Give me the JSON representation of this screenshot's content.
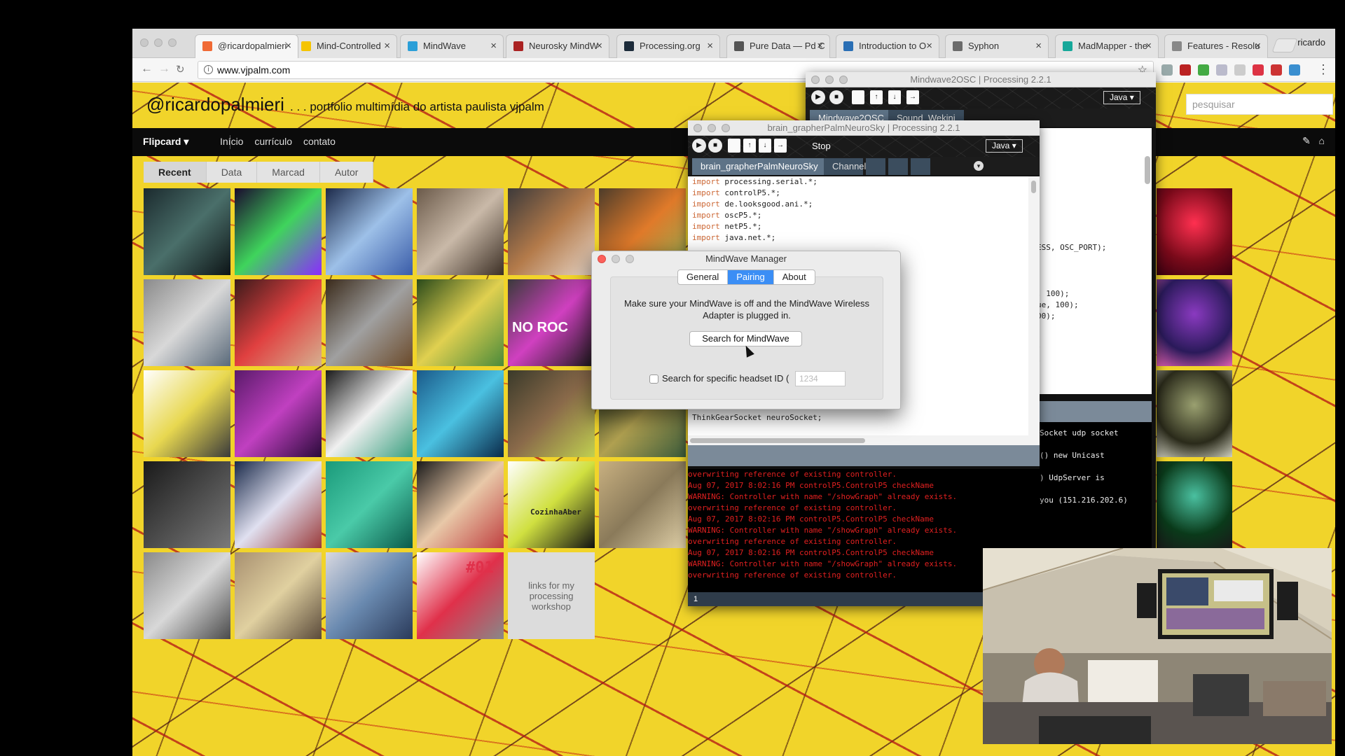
{
  "browser": {
    "profile": "ricardo",
    "url": "www.vjpalm.com",
    "tabs": [
      {
        "label": "@ricardopalmieri",
        "favicon": "blogger-icon",
        "color": "#f06a35"
      },
      {
        "label": "Mind-Controlled",
        "favicon": "instructables-icon",
        "color": "#f5c400"
      },
      {
        "label": "MindWave",
        "favicon": "globe-icon",
        "color": "#2b9fd8"
      },
      {
        "label": "Neurosky MindW",
        "favicon": "neurosky-icon",
        "color": "#aa2222"
      },
      {
        "label": "Processing.org",
        "favicon": "processing-icon",
        "color": "#1c2b3a"
      },
      {
        "label": "Pure Data — Pd C",
        "favicon": "puredata-icon",
        "color": "#555555"
      },
      {
        "label": "Introduction to O",
        "favicon": "globe-icon",
        "color": "#2a6fb5"
      },
      {
        "label": "Syphon",
        "favicon": "syphon-icon",
        "color": "#6b6b6b"
      },
      {
        "label": "MadMapper - the",
        "favicon": "madmapper-icon",
        "color": "#16a89a"
      },
      {
        "label": "Features - Resolu",
        "favicon": "document-icon",
        "color": "#888888"
      }
    ]
  },
  "site": {
    "title": "@ricardopalmieri",
    "tagline": ". . . portfolio multimídia do artista paulista vjpalm",
    "nav_menu": "Flipcard",
    "nav_links": [
      "Início",
      "currículo",
      "contato"
    ],
    "search_placeholder": "pesquisar",
    "filters": [
      "Recent",
      "Data",
      "Marcad",
      "Autor"
    ],
    "tiles": [
      {
        "label": "",
        "colors": [
          "#1b2a2e",
          "#4a6f6a",
          "#0d1416"
        ]
      },
      {
        "label": "",
        "colors": [
          "#1a0a2e",
          "#3fd45c",
          "#8b2bff"
        ]
      },
      {
        "label": "",
        "colors": [
          "#1c2a4a",
          "#9dc0e8",
          "#3a5ca8"
        ]
      },
      {
        "label": "",
        "colors": [
          "#6b5a4a",
          "#c9b9a8",
          "#3c2f25"
        ]
      },
      {
        "label": "",
        "colors": [
          "#3d3a3a",
          "#b37a4a",
          "#e8d7c9"
        ]
      },
      {
        "label": "",
        "colors": [
          "#4d3c2a",
          "#e07a2a",
          "#8bb054"
        ]
      },
      {
        "label": "",
        "colors": [
          "#8a8a8a",
          "#d8d8d8",
          "#5a6a7a"
        ]
      },
      {
        "label": "",
        "colors": [
          "#3a1a1a",
          "#e04040",
          "#d6b090"
        ]
      },
      {
        "label": "",
        "colors": [
          "#3a2a1a",
          "#a0a0a0",
          "#6b4a2a"
        ]
      },
      {
        "label": "",
        "colors": [
          "#2a4a1a",
          "#e0d050",
          "#4a8a3a"
        ]
      },
      {
        "label": "NO ROC",
        "colors": [
          "#3a3a3a",
          "#d040c0",
          "#1a1a1a"
        ]
      },
      {
        "label": "",
        "colors": [
          "#2a1a3a",
          "#4a4a8a",
          "#c08a60"
        ]
      },
      {
        "label": "",
        "colors": [
          "#ffffff",
          "#e8d850",
          "#3a3a3a"
        ]
      },
      {
        "label": "",
        "colors": [
          "#5a1a6a",
          "#c040c0",
          "#2a0a3a"
        ]
      },
      {
        "label": "",
        "colors": [
          "#1a1a1a",
          "#f0f0f0",
          "#3aa080"
        ]
      },
      {
        "label": "",
        "colors": [
          "#1a5a8a",
          "#4ac0e0",
          "#0a2a4a"
        ]
      },
      {
        "label": "",
        "colors": [
          "#3a3a2a",
          "#8a6a4a",
          "#c0d050"
        ]
      },
      {
        "label": "",
        "colors": [
          "#1a2a1a",
          "#b0a050",
          "#3a5a3a"
        ]
      },
      {
        "label": "",
        "colors": [
          "#1a1a1a",
          "#4a4a4a",
          "#7a7a7a"
        ]
      },
      {
        "label": "",
        "colors": [
          "#1a2a4a",
          "#e0e0f0",
          "#9a3a3a"
        ]
      },
      {
        "label": "",
        "colors": [
          "#1a9a7a",
          "#4acaa8",
          "#0a5a4a"
        ]
      },
      {
        "label": "",
        "colors": [
          "#1a1a1a",
          "#e8c8a8",
          "#c04040"
        ]
      },
      {
        "label": "CozinhaAber",
        "colors": [
          "#ffffff",
          "#d0e040",
          "#111111"
        ]
      },
      {
        "label": "",
        "colors": [
          "#c8b080",
          "#8a7a5a",
          "#e0d0a8"
        ]
      },
      {
        "label": "",
        "colors": [
          "#8a8a8a",
          "#d8d8d8",
          "#4a4a4a"
        ]
      },
      {
        "label": "",
        "colors": [
          "#a89070",
          "#e0d0a0",
          "#5a4a3a"
        ]
      },
      {
        "label": "",
        "colors": [
          "#d8d8e0",
          "#6a8ab0",
          "#2a3a5a"
        ]
      },
      {
        "label": "#01",
        "colors": [
          "#ffffff",
          "#e0304a",
          "#888888"
        ]
      },
      {
        "label": "links for my processing workshop",
        "colors": [
          "#dcdcdc",
          "#dcdcdc",
          "#dcdcdc"
        ]
      }
    ],
    "right_tiles": [
      {
        "colors": [
          "#7a0a1a",
          "#ff3050",
          "#3a0010"
        ]
      },
      {
        "colors": [
          "#2a1a5a",
          "#8a3ac0",
          "#e060b0"
        ]
      },
      {
        "colors": [
          "#2a2a1a",
          "#9aa070",
          "#d0d0c0"
        ]
      },
      {
        "colors": [
          "#0a3a1a",
          "#4ac0a0",
          "#1a1a1a"
        ]
      }
    ]
  },
  "processing_back": {
    "title": "Mindwave2OSC | Processing 2.2.1",
    "mode": "Java",
    "tabs": [
      "Mindwave2OSC",
      "Sound_Wekini"
    ],
    "code_fragments": [
      "ESS, OSC_PORT);",
      ", 100);",
      "ue, 100);",
      "00);",
      ";",
      ";"
    ],
    "console": [
      "Socket udp socket",
      "() new Unicast",
      ") UdpServer is",
      "you (151.216.202.6)"
    ]
  },
  "processing_front": {
    "title": "brain_grapherPalmNeuroSky | Processing 2.2.1",
    "stop_label": "Stop",
    "mode": "Java",
    "tabs": [
      "brain_grapherPalmNeuroSky",
      "Channel"
    ],
    "code": [
      {
        "kw": "import",
        "rest": " processing.serial.*;"
      },
      {
        "kw": "import",
        "rest": " controlP5.*;"
      },
      {
        "kw": "import",
        "rest": " de.looksgood.ani.*;"
      },
      {
        "kw": "import",
        "rest": " oscP5.*;"
      },
      {
        "kw": "import",
        "rest": " netP5.*;"
      },
      {
        "kw": "import",
        "rest": " java.net.*;"
      }
    ],
    "code_bottom": "ThinkGearSocket neuroSocket;",
    "console": [
      "overwriting reference of existing controller.",
      "Aug 07, 2017 8:02:16 PM controlP5.ControlP5 checkName",
      "WARNING: Controller with name \"/showGraph\" already exists.",
      "overwriting reference of existing controller.",
      "Aug 07, 2017 8:02:16 PM controlP5.ControlP5 checkName",
      "WARNING: Controller with name \"/showGraph\" already exists.",
      "overwriting reference of existing controller.",
      "Aug 07, 2017 8:02:16 PM controlP5.ControlP5 checkName",
      "WARNING: Controller with name \"/showGraph\" already exists.",
      "overwriting reference of existing controller."
    ],
    "line_number": "1"
  },
  "dialog": {
    "title": "MindWave Manager",
    "tabs": [
      "General",
      "Pairing",
      "About"
    ],
    "active_tab": "Pairing",
    "message": "Make sure your MindWave is off and the MindWave Wireless Adapter is plugged in.",
    "search_button": "Search for MindWave",
    "checkbox_label": "Search for specific headset ID (",
    "id_placeholder": "1234"
  }
}
